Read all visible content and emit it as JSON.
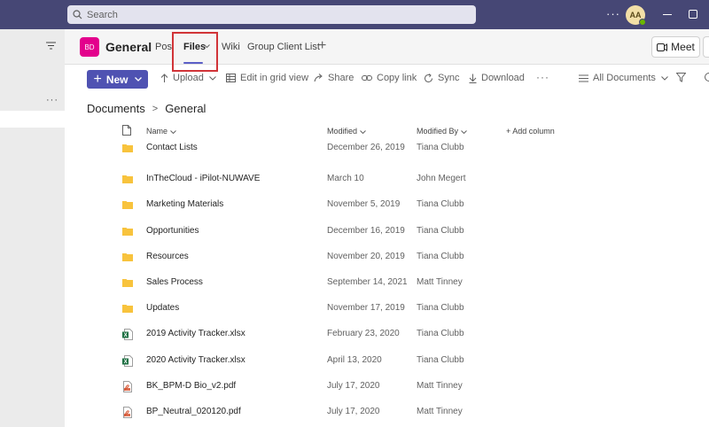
{
  "topbar": {
    "search_placeholder": "Search",
    "more": "···",
    "avatar_initials": "AA"
  },
  "left": {
    "more": "···"
  },
  "channel": {
    "team_initials": "BD",
    "name": "General",
    "tabs": {
      "posts": "Posts",
      "files": "Files",
      "wiki": "Wiki",
      "group_client_list": "Group Client List",
      "add": "+"
    },
    "meet": "Meet"
  },
  "toolbar": {
    "new": "New",
    "upload": "Upload",
    "edit_grid": "Edit in grid view",
    "share": "Share",
    "copy_link": "Copy link",
    "sync": "Sync",
    "download": "Download",
    "more": "···",
    "all_documents": "All Documents"
  },
  "breadcrumb": {
    "root": "Documents",
    "current": "General",
    "separator": ">"
  },
  "columns": {
    "name": "Name",
    "modified": "Modified",
    "modified_by": "Modified By",
    "add_column": "+ Add column"
  },
  "files": [
    {
      "type": "folder",
      "name": "Contact Lists",
      "modified": "December 26, 2019",
      "modified_by": "Tiana Clubb"
    },
    {
      "type": "folder",
      "name": "InTheCloud - iPilot-NUWAVE",
      "modified": "March 10",
      "modified_by": "John Megert"
    },
    {
      "type": "folder",
      "name": "Marketing Materials",
      "modified": "November 5, 2019",
      "modified_by": "Tiana Clubb"
    },
    {
      "type": "folder",
      "name": "Opportunities",
      "modified": "December 16, 2019",
      "modified_by": "Tiana Clubb"
    },
    {
      "type": "folder",
      "name": "Resources",
      "modified": "November 20, 2019",
      "modified_by": "Tiana Clubb"
    },
    {
      "type": "folder",
      "name": "Sales Process",
      "modified": "September 14, 2021",
      "modified_by": "Matt Tinney"
    },
    {
      "type": "folder",
      "name": "Updates",
      "modified": "November 17, 2019",
      "modified_by": "Tiana Clubb"
    },
    {
      "type": "xlsx",
      "name": "2019 Activity Tracker.xlsx",
      "modified": "February 23, 2020",
      "modified_by": "Tiana Clubb"
    },
    {
      "type": "xlsx",
      "name": "2020 Activity Tracker.xlsx",
      "modified": "April 13, 2020",
      "modified_by": "Tiana Clubb"
    },
    {
      "type": "pdf",
      "name": "BK_BPM-D Bio_v2.pdf",
      "modified": "July 17, 2020",
      "modified_by": "Matt Tinney"
    },
    {
      "type": "pdf",
      "name": "BP_Neutral_020120.pdf",
      "modified": "July 17, 2020",
      "modified_by": "Matt Tinney"
    }
  ],
  "colors": {
    "titlebar": "#464775",
    "accent": "#4f52b2",
    "team_badge": "#e3008c",
    "highlight_box": "#d13438",
    "folder": "#f8c33d",
    "excel": "#1d6f42",
    "pdf": "#d65532"
  }
}
